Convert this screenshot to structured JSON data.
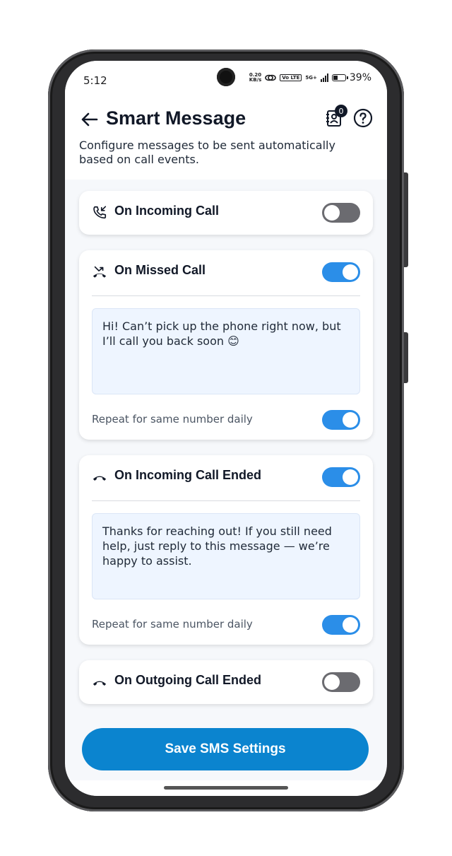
{
  "status_bar": {
    "time": "5:12",
    "net_speed_value": "0.20",
    "net_speed_unit": "KB/s",
    "volte": "Vo LTE",
    "network": "5G+",
    "battery": "39%"
  },
  "header": {
    "title": "Smart Message",
    "subtitle": "Configure messages to be sent automatically based on call events.",
    "badge_count": "0"
  },
  "cards": [
    {
      "title": "On Incoming Call",
      "icon": "incoming-call-icon",
      "enabled": false
    },
    {
      "title": "On Missed Call",
      "icon": "missed-call-icon",
      "enabled": true,
      "message": "Hi! Can’t pick up the phone right now, but I’ll call you back soon 😊",
      "repeat_label": "Repeat for same number daily",
      "repeat_enabled": true
    },
    {
      "title": "On Incoming Call Ended",
      "icon": "call-end-icon",
      "enabled": true,
      "message": "Thanks for reaching out! If you still need help, just reply to this message — we’re happy to assist.",
      "repeat_label": "Repeat for same number daily",
      "repeat_enabled": true
    },
    {
      "title": "On Outgoing Call Ended",
      "icon": "call-end-icon",
      "enabled": false
    }
  ],
  "save_button": {
    "label": "Save SMS Settings"
  },
  "colors": {
    "accent": "#0b84cf",
    "toggle_on": "#2b8ee8",
    "toggle_off": "#6b6b70",
    "message_bg": "#eef5ff"
  }
}
